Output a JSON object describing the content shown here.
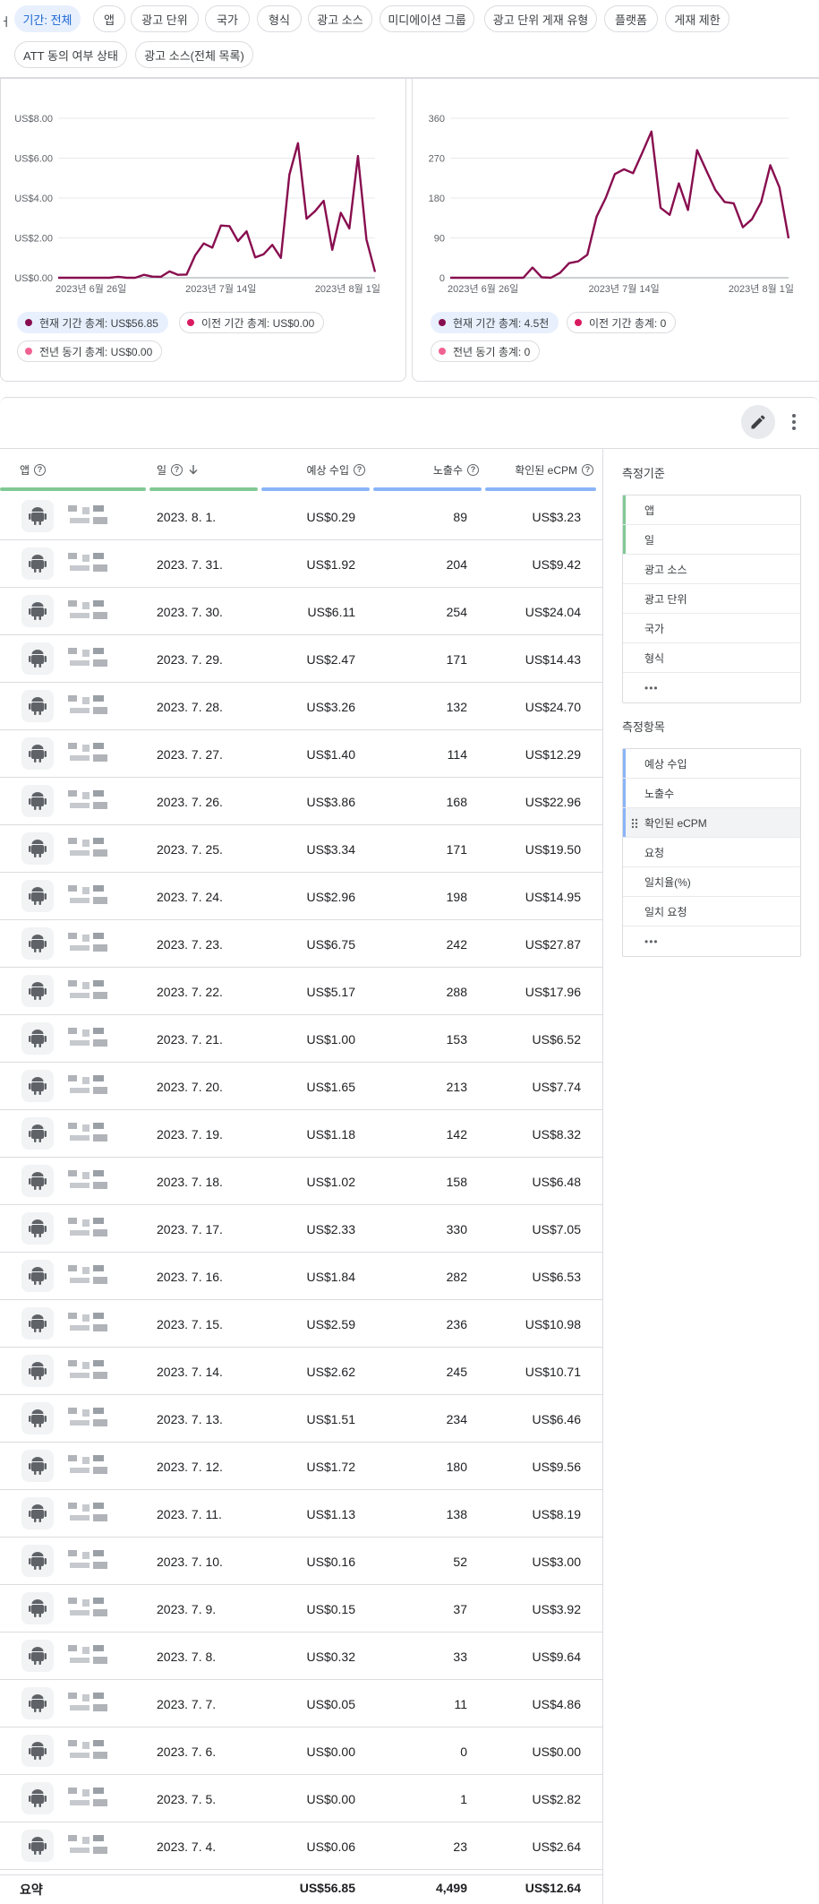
{
  "filters": {
    "edge_text": "ㅓ",
    "chips": [
      "기간: 전체",
      "앱",
      "광고 단위",
      "국가",
      "형식",
      "광고 소스",
      "미디에이션 그룹",
      "광고 단위 게재 유형",
      "플랫폼",
      "게재 제한",
      "ATT 동의 여부 상태",
      "광고 소스(전체 목록)"
    ]
  },
  "colors": {
    "series_current": "#880e4f",
    "series_previous": "#d81b60",
    "series_last_year": "#f06292",
    "accent_green": "#81c995",
    "accent_blue": "#8ab4f8",
    "chip_active_bg": "#e8f0fe"
  },
  "chart_data": [
    {
      "type": "line",
      "x_labels": [
        "2023년 6월 26일",
        "2023년 7월 14일",
        "2023년 8월 1일"
      ],
      "y_ticks": [
        "US$0.00",
        "US$2.00",
        "US$4.00",
        "US$6.00",
        "US$8.00"
      ],
      "ylim": [
        0,
        8
      ],
      "series": [
        {
          "values": [
            0,
            0,
            0,
            0,
            0,
            0,
            0,
            0.05,
            0,
            0,
            0.15,
            0.06,
            0.05,
            0.32,
            0.15,
            0.16,
            1.13,
            1.72,
            1.51,
            2.62,
            2.59,
            1.84,
            2.33,
            1.02,
            1.18,
            1.65,
            1.0,
            5.17,
            6.75,
            2.96,
            3.34,
            3.86,
            1.4,
            3.26,
            2.47,
            6.11,
            1.92,
            0.29
          ]
        }
      ],
      "legend": [
        {
          "label": "현재 기간 총계: US$56.85",
          "color": "#880e4f",
          "active": true
        },
        {
          "label": "이전 기간 총계: US$0.00",
          "color": "#d81b60",
          "active": false
        },
        {
          "label": "전년 동기 총계: US$0.00",
          "color": "#f06292",
          "active": false
        }
      ]
    },
    {
      "type": "line",
      "x_labels": [
        "2023년 6월 26일",
        "2023년 7월 14일",
        "2023년 8월 1일"
      ],
      "y_ticks": [
        "0",
        "90",
        "180",
        "270",
        "360"
      ],
      "ylim": [
        0,
        360
      ],
      "series": [
        {
          "values": [
            0,
            0,
            0,
            0,
            0,
            0,
            0,
            0,
            0,
            23,
            1,
            0,
            11,
            33,
            37,
            52,
            138,
            180,
            234,
            245,
            236,
            282,
            330,
            158,
            142,
            213,
            153,
            288,
            242,
            198,
            171,
            168,
            114,
            132,
            171,
            254,
            204,
            89
          ]
        }
      ],
      "legend": [
        {
          "label": "현재 기간 총계: 4.5천",
          "color": "#880e4f",
          "active": true
        },
        {
          "label": "이전 기간 총계: 0",
          "color": "#d81b60",
          "active": false
        },
        {
          "label": "전년 동기 총계: 0",
          "color": "#f06292",
          "active": false
        }
      ]
    }
  ],
  "table": {
    "headers": {
      "app": "앱",
      "date": "일",
      "revenue": "예상 수입",
      "impressions": "노출수",
      "ecpm": "확인된 eCPM"
    },
    "rows": [
      {
        "date": "2023. 8. 1.",
        "revenue": "US$0.29",
        "impressions": "89",
        "ecpm": "US$3.23"
      },
      {
        "date": "2023. 7. 31.",
        "revenue": "US$1.92",
        "impressions": "204",
        "ecpm": "US$9.42"
      },
      {
        "date": "2023. 7. 30.",
        "revenue": "US$6.11",
        "impressions": "254",
        "ecpm": "US$24.04"
      },
      {
        "date": "2023. 7. 29.",
        "revenue": "US$2.47",
        "impressions": "171",
        "ecpm": "US$14.43"
      },
      {
        "date": "2023. 7. 28.",
        "revenue": "US$3.26",
        "impressions": "132",
        "ecpm": "US$24.70"
      },
      {
        "date": "2023. 7. 27.",
        "revenue": "US$1.40",
        "impressions": "114",
        "ecpm": "US$12.29"
      },
      {
        "date": "2023. 7. 26.",
        "revenue": "US$3.86",
        "impressions": "168",
        "ecpm": "US$22.96"
      },
      {
        "date": "2023. 7. 25.",
        "revenue": "US$3.34",
        "impressions": "171",
        "ecpm": "US$19.50"
      },
      {
        "date": "2023. 7. 24.",
        "revenue": "US$2.96",
        "impressions": "198",
        "ecpm": "US$14.95"
      },
      {
        "date": "2023. 7. 23.",
        "revenue": "US$6.75",
        "impressions": "242",
        "ecpm": "US$27.87"
      },
      {
        "date": "2023. 7. 22.",
        "revenue": "US$5.17",
        "impressions": "288",
        "ecpm": "US$17.96"
      },
      {
        "date": "2023. 7. 21.",
        "revenue": "US$1.00",
        "impressions": "153",
        "ecpm": "US$6.52"
      },
      {
        "date": "2023. 7. 20.",
        "revenue": "US$1.65",
        "impressions": "213",
        "ecpm": "US$7.74"
      },
      {
        "date": "2023. 7. 19.",
        "revenue": "US$1.18",
        "impressions": "142",
        "ecpm": "US$8.32"
      },
      {
        "date": "2023. 7. 18.",
        "revenue": "US$1.02",
        "impressions": "158",
        "ecpm": "US$6.48"
      },
      {
        "date": "2023. 7. 17.",
        "revenue": "US$2.33",
        "impressions": "330",
        "ecpm": "US$7.05"
      },
      {
        "date": "2023. 7. 16.",
        "revenue": "US$1.84",
        "impressions": "282",
        "ecpm": "US$6.53"
      },
      {
        "date": "2023. 7. 15.",
        "revenue": "US$2.59",
        "impressions": "236",
        "ecpm": "US$10.98"
      },
      {
        "date": "2023. 7. 14.",
        "revenue": "US$2.62",
        "impressions": "245",
        "ecpm": "US$10.71"
      },
      {
        "date": "2023. 7. 13.",
        "revenue": "US$1.51",
        "impressions": "234",
        "ecpm": "US$6.46"
      },
      {
        "date": "2023. 7. 12.",
        "revenue": "US$1.72",
        "impressions": "180",
        "ecpm": "US$9.56"
      },
      {
        "date": "2023. 7. 11.",
        "revenue": "US$1.13",
        "impressions": "138",
        "ecpm": "US$8.19"
      },
      {
        "date": "2023. 7. 10.",
        "revenue": "US$0.16",
        "impressions": "52",
        "ecpm": "US$3.00"
      },
      {
        "date": "2023. 7. 9.",
        "revenue": "US$0.15",
        "impressions": "37",
        "ecpm": "US$3.92"
      },
      {
        "date": "2023. 7. 8.",
        "revenue": "US$0.32",
        "impressions": "33",
        "ecpm": "US$9.64"
      },
      {
        "date": "2023. 7. 7.",
        "revenue": "US$0.05",
        "impressions": "11",
        "ecpm": "US$4.86"
      },
      {
        "date": "2023. 7. 6.",
        "revenue": "US$0.00",
        "impressions": "0",
        "ecpm": "US$0.00"
      },
      {
        "date": "2023. 7. 5.",
        "revenue": "US$0.00",
        "impressions": "1",
        "ecpm": "US$2.82"
      },
      {
        "date": "2023. 7. 4.",
        "revenue": "US$0.06",
        "impressions": "23",
        "ecpm": "US$2.64"
      }
    ],
    "summary": {
      "label": "요약",
      "revenue": "US$56.85",
      "impressions": "4,499",
      "ecpm": "US$12.64"
    }
  },
  "panel": {
    "dimensions_title": "측정기준",
    "dimensions": [
      "앱",
      "일",
      "광고 소스",
      "광고 단위",
      "국가",
      "형식"
    ],
    "metrics_title": "측정항목",
    "metrics": [
      "예상 수입",
      "노출수",
      "확인된 eCPM",
      "요청",
      "일치율(%)",
      "일치 요청"
    ],
    "more": "•••"
  },
  "icons": {
    "edit": "pencil-icon",
    "more": "more-vert-icon",
    "help": "help-icon",
    "sort": "arrow-down-icon",
    "app": "android-icon",
    "drag": "drag-handle-icon"
  }
}
